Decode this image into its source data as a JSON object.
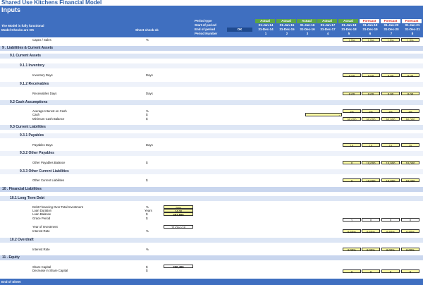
{
  "app": {
    "title": "Shared Use Kitchens Financial Model",
    "sheet_title": "Inputs"
  },
  "header": {
    "status_line1": "The Model is fully functional",
    "status_line2": "Model Checks are OK",
    "sheet_check": "Sheet check ok",
    "ok_label": "OK",
    "row_labels": [
      "Period type",
      "Start of period",
      "End of period",
      "Period Number"
    ],
    "periods": [
      {
        "type": "Actual",
        "start": "01-Jan-14",
        "end": "31-Dec-14",
        "num": "1"
      },
      {
        "type": "Actual",
        "start": "01-Jan-15",
        "end": "31-Dec-15",
        "num": "2"
      },
      {
        "type": "Actual",
        "start": "01-Jan-16",
        "end": "31-Dec-16",
        "num": "3"
      },
      {
        "type": "Actual",
        "start": "01-Jan-17",
        "end": "31-Dec-17",
        "num": "4"
      },
      {
        "type": "Actual",
        "start": "01-Jan-18",
        "end": "31-Dec-18",
        "num": "5"
      },
      {
        "type": "Forecast",
        "start": "01-Jan-19",
        "end": "31-Dec-19",
        "num": "6"
      },
      {
        "type": "Forecast",
        "start": "01-Jan-20",
        "end": "31-Dec-20",
        "num": "7"
      },
      {
        "type": "Forecast",
        "start": "01-Jan-21",
        "end": "31-Dec-21",
        "num": "8"
      }
    ]
  },
  "capex_row": {
    "label": "Capex / Sales",
    "unit": "%",
    "values": [
      "1.0%",
      "1.0%",
      "1.0%",
      "1.0%"
    ]
  },
  "sections": {
    "s9": "9 . Liabilities & Current Assets",
    "s9_1": "9.1  Current Assets",
    "s9_1_1": "9.1.1  Inventory",
    "s9_1_2": "9.1.2  Receivables",
    "s9_2": "9.2  Cash Assumptions",
    "s9_3": "9.3  Current Liabilities",
    "s9_3_1": "9.3.1  Payables",
    "s9_3_2": "9.3.2  Other Payables",
    "s9_3_3": "9.3.3  Other Current Liabilities",
    "s10": "10 . Financial Liabilities",
    "s10_1": "10.1  Long Term Debt",
    "s10_2": "10.2  Overdraft",
    "s11": "11 . Equity"
  },
  "rows": {
    "inventory_days": {
      "label": "Inventory Days",
      "unit": "Days",
      "values": [
        "0.00",
        "0.00",
        "0.00",
        "0.00"
      ]
    },
    "receivables_days": {
      "label": "Receivables Days",
      "unit": "Days",
      "values": [
        "0.00",
        "0.00",
        "0.00",
        "0.00"
      ]
    },
    "avg_interest_cash": {
      "label": "Average Interest on Cash",
      "unit": "%",
      "values": [
        "1%",
        "1%",
        "1%",
        "1%"
      ]
    },
    "cash": {
      "label": "Cash",
      "unit": "$",
      "value": "-"
    },
    "min_cash": {
      "label": "Minimum Cash Balance",
      "unit": "$",
      "values": [
        "50,000",
        "50,000",
        "50,000",
        "50,000"
      ]
    },
    "payables_days": {
      "label": "Payables Days",
      "unit": "Days",
      "values": [
        "15",
        "15",
        "15",
        "15"
      ]
    },
    "other_payables": {
      "label": "Other Payables Balance",
      "unit": "$",
      "values": [
        "0",
        "10,000",
        "10,000",
        "10,000"
      ]
    },
    "other_cl": {
      "label": "Other Current Liabilities",
      "unit": "$",
      "values": [
        "0",
        "10,000",
        "10,000",
        "10,000"
      ]
    },
    "debt_fin": {
      "label": "Debt Financing Over Total Investment",
      "unit": "%",
      "value": "70%"
    },
    "loan_duration": {
      "label": "Loan Duration",
      "unit": "Years",
      "value": "14.00"
    },
    "loan_balance": {
      "label": "Loan Balance",
      "unit": "$",
      "value": "467,600"
    },
    "grace_period": {
      "label": "Grace Period",
      "unit": "$",
      "values": [
        "1",
        "0",
        "0",
        "0"
      ]
    },
    "year_investment": {
      "label": "Year of Investment",
      "value": "31-Dec-18"
    },
    "interest_rate_ltd": {
      "label": "Interest Rate",
      "unit": "%",
      "values": [
        "6.50%",
        "6.50%",
        "6.50%",
        "6.50%"
      ]
    },
    "interest_rate_od": {
      "label": "Interest Rate",
      "unit": "%",
      "values": [
        "8.00%",
        "8.00%",
        "8.00%",
        "8.00%"
      ]
    },
    "share_capital": {
      "label": "Share Capital",
      "unit": "$",
      "value": "200,400"
    },
    "decrease_share": {
      "label": "Decrease in Share Capital",
      "unit": "$",
      "values": [
        "0",
        "0",
        "0",
        "0"
      ]
    }
  },
  "footer": {
    "label": "End of Sheet"
  },
  "colors": {
    "header_blue": "#3f6fc0",
    "actual_green": "#5ea646",
    "forecast_red": "#d9261c",
    "input_yellow": "#ffffa8"
  }
}
